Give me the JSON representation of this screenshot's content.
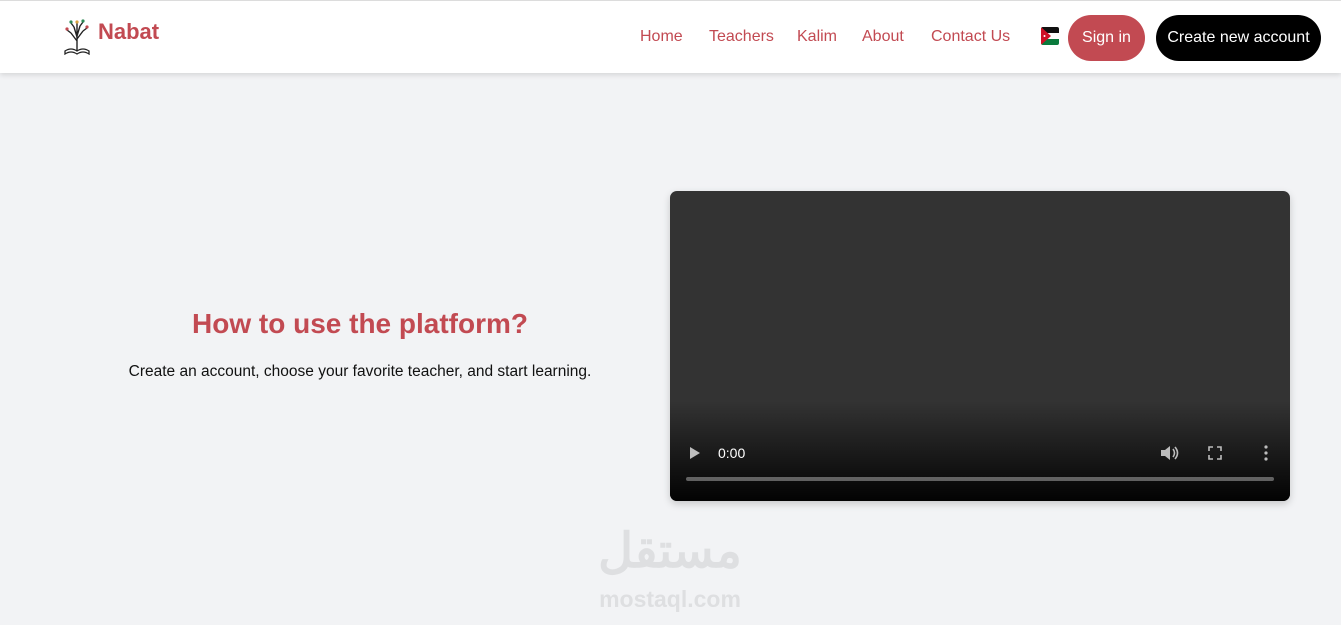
{
  "brand": {
    "name": "Nabat",
    "logo_icon": "tree-book-icon",
    "color": "#c24a52"
  },
  "nav": {
    "links": [
      {
        "label": "Home"
      },
      {
        "label": "Teachers"
      },
      {
        "label": "Kalim"
      },
      {
        "label": "About"
      },
      {
        "label": "Contact Us"
      }
    ],
    "language_flag": "jordan-flag-icon",
    "signin_label": "Sign in",
    "create_account_label": "Create new account"
  },
  "hero": {
    "title": "How to use the platform?",
    "subtitle": "Create an account, choose your favorite teacher, and start learning."
  },
  "video": {
    "current_time": "0:00",
    "progress": 0,
    "controls": [
      "play-icon",
      "volume-icon",
      "fullscreen-icon",
      "more-options-icon"
    ]
  },
  "watermark": {
    "arabic": "مستقل",
    "latin": "mostaql.com"
  },
  "colors": {
    "accent": "#c24a52",
    "background": "#f2f3f5",
    "dark_button": "#000000",
    "video_bg": "#333333"
  }
}
